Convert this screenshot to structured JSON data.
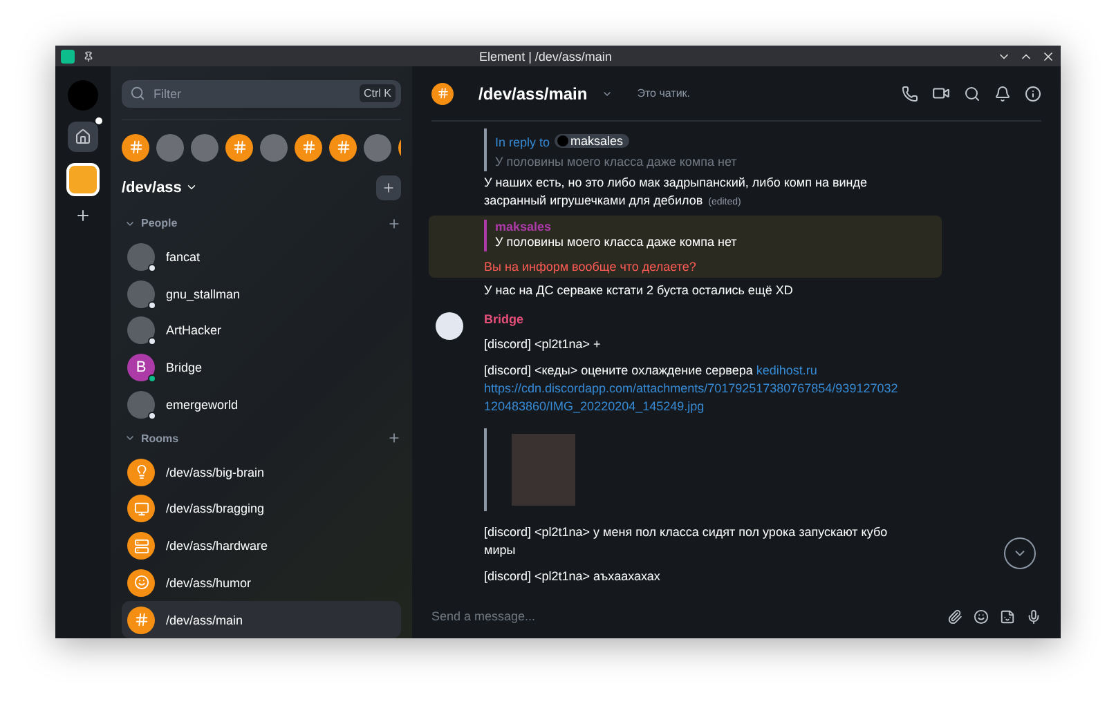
{
  "window": {
    "title": "Element | /dev/ass/main"
  },
  "rail": {
    "home_unread": true,
    "spaces": [
      {
        "selected": true
      }
    ]
  },
  "filter": {
    "placeholder": "Filter",
    "shortcut": "Ctrl K"
  },
  "space_strip": [
    {
      "kind": "room"
    },
    {
      "kind": "photo"
    },
    {
      "kind": "photo"
    },
    {
      "kind": "room"
    },
    {
      "kind": "photo"
    },
    {
      "kind": "room"
    },
    {
      "kind": "room"
    },
    {
      "kind": "photo"
    },
    {
      "kind": "room"
    }
  ],
  "space": {
    "name": "/dev/ass"
  },
  "people": {
    "title": "People",
    "expanded": true,
    "members": [
      {
        "name": "fancat",
        "online": false
      },
      {
        "name": "gnu_stallman",
        "online": false
      },
      {
        "name": "ArtHacker",
        "online": false
      },
      {
        "name": "Bridge",
        "letter": "B",
        "online": true
      },
      {
        "name": "emergeworld",
        "online": false
      }
    ]
  },
  "rooms": {
    "title": "Rooms",
    "expanded": true,
    "items": [
      {
        "name": "/dev/ass/big-brain",
        "selected": false
      },
      {
        "name": "/dev/ass/bragging",
        "selected": false
      },
      {
        "name": "/dev/ass/hardware",
        "selected": false
      },
      {
        "name": "/dev/ass/humor",
        "selected": false
      },
      {
        "name": "/dev/ass/main",
        "selected": true
      }
    ]
  },
  "header": {
    "room": "/dev/ass/main",
    "topic": "Это чатик."
  },
  "messages": [
    {
      "kind": "reply",
      "reply_label": "In reply to",
      "reply_user": "maksales",
      "quote": "У половины моего класса даже компа нет",
      "text": "У наших есть, но это либо мак задрыпанский, либо комп на винде засранный игрушечками для дебилов",
      "edited": "(edited)"
    },
    {
      "kind": "quote",
      "highlight": true,
      "user": "maksales",
      "quote": "У половины моего класса даже компа нет",
      "text": "Вы на информ вообще что делаете?"
    },
    {
      "kind": "plain",
      "text": "У нас на ДС серваке кстати 2 буста остались ещё XD"
    },
    {
      "kind": "sender",
      "sender": "Bridge"
    },
    {
      "kind": "plain",
      "text": "[discord] <pl2t1na> +"
    },
    {
      "kind": "link",
      "text": "[discord] <кеды> оцените охлаждение сервера",
      "link": "kedihost.ru",
      "url": "https://cdn.discordapp.com/attachments/701792517380767854/939127032120483860/IMG_20220204_145249.jpg"
    },
    {
      "kind": "image"
    },
    {
      "kind": "plain",
      "text": "[discord] <pl2t1na> у меня пол класса сидят пол урока запускают кубо миры"
    },
    {
      "kind": "plain",
      "text": "[discord] <pl2t1na> аъхаахахах"
    }
  ],
  "composer": {
    "placeholder": "Send a message..."
  }
}
